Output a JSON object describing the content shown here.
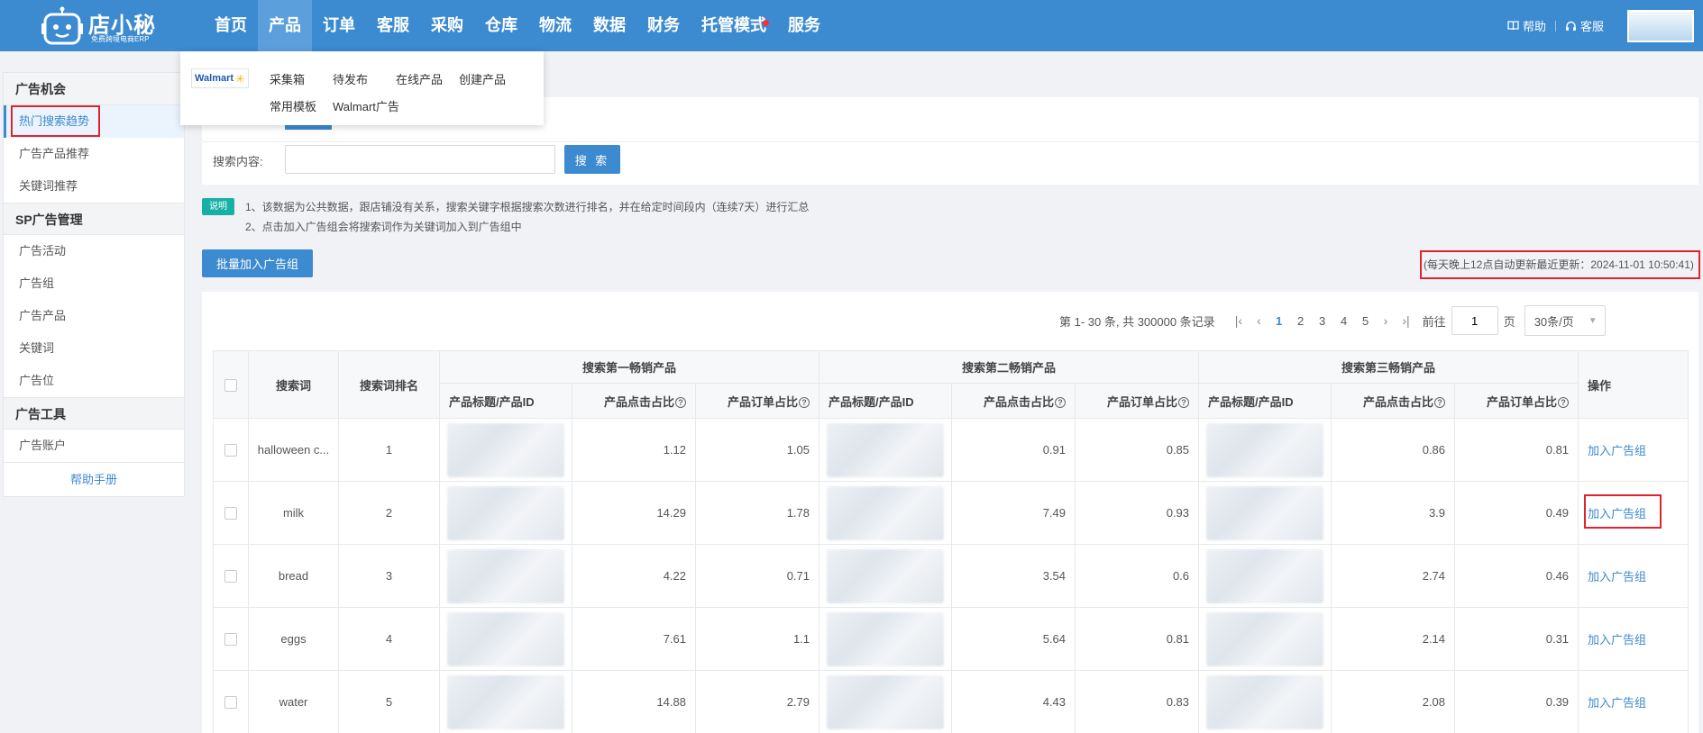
{
  "brand": {
    "name": "店小秘",
    "tagline": "免费跨境电商ERP"
  },
  "nav": [
    {
      "label": "首页"
    },
    {
      "label": "产品"
    },
    {
      "label": "订单"
    },
    {
      "label": "客服"
    },
    {
      "label": "采购"
    },
    {
      "label": "仓库"
    },
    {
      "label": "物流"
    },
    {
      "label": "数据"
    },
    {
      "label": "财务"
    },
    {
      "label": "托管模式"
    },
    {
      "label": "服务"
    }
  ],
  "top_right": {
    "help": "帮助",
    "service": "客服"
  },
  "dropdown": {
    "logo_text": "Walmart",
    "items": [
      "采集箱",
      "待发布",
      "在线产品",
      "创建产品",
      "常用模板",
      "Walmart广告"
    ]
  },
  "sidebar": {
    "group1": "广告机会",
    "group1_items": [
      "热门搜索趋势",
      "广告产品推荐",
      "关键词推荐"
    ],
    "group2": "SP广告管理",
    "group2_items": [
      "广告活动",
      "广告组",
      "广告产品",
      "关键词",
      "广告位"
    ],
    "group3": "广告工具",
    "group3_items": [
      "广告账户"
    ],
    "help": "帮助手册"
  },
  "search": {
    "label": "搜索内容:",
    "value": "",
    "button": "搜 索"
  },
  "note": {
    "badge": "说明",
    "line1": "1、该数据为公共数据，跟店铺没有关系，搜索关键字根据搜索次数进行排名，并在给定时间段内（连续7天）进行汇总",
    "line2": "2、点击加入广告组会将搜索词作为关键词加入到广告组中"
  },
  "batch_button": "批量加入广告组",
  "update_text": "(每天晚上12点自动更新最近更新：2024-11-01 10:50:41)",
  "pager": {
    "summary": "第 1- 30 条, 共 300000 条记录",
    "pages": [
      "1",
      "2",
      "3",
      "4",
      "5"
    ],
    "current": "1",
    "goto_label": "前往",
    "goto_value": "1",
    "page_unit": "页",
    "page_size": "30条/页"
  },
  "table": {
    "col_keyword": "搜索词",
    "col_rank": "搜索词排名",
    "group_headers": [
      "搜索第一畅销产品",
      "搜索第二畅销产品",
      "搜索第三畅销产品"
    ],
    "sub_title": "产品标题/产品ID",
    "sub_click": "产品点击占比",
    "sub_order": "产品订单占比",
    "col_action": "操作",
    "action_label": "加入广告组",
    "rows": [
      {
        "keyword": "halloween c...",
        "rank": "1",
        "p1_click": "1.12",
        "p1_order": "1.05",
        "p2_click": "0.91",
        "p2_order": "0.85",
        "p3_click": "0.86",
        "p3_order": "0.81"
      },
      {
        "keyword": "milk",
        "rank": "2",
        "p1_click": "14.29",
        "p1_order": "1.78",
        "p2_click": "7.49",
        "p2_order": "0.93",
        "p3_click": "3.9",
        "p3_order": "0.49"
      },
      {
        "keyword": "bread",
        "rank": "3",
        "p1_click": "4.22",
        "p1_order": "0.71",
        "p2_click": "3.54",
        "p2_order": "0.6",
        "p3_click": "2.74",
        "p3_order": "0.46"
      },
      {
        "keyword": "eggs",
        "rank": "4",
        "p1_click": "7.61",
        "p1_order": "1.1",
        "p2_click": "5.64",
        "p2_order": "0.81",
        "p3_click": "2.14",
        "p3_order": "0.31"
      },
      {
        "keyword": "water",
        "rank": "5",
        "p1_click": "14.88",
        "p1_order": "2.79",
        "p2_click": "4.43",
        "p2_order": "0.83",
        "p3_click": "2.08",
        "p3_order": "0.39"
      }
    ]
  },
  "colors": {
    "primary": "#3c8ad0",
    "highlight_box": "#e0242f",
    "note_badge": "#16b1a4"
  }
}
